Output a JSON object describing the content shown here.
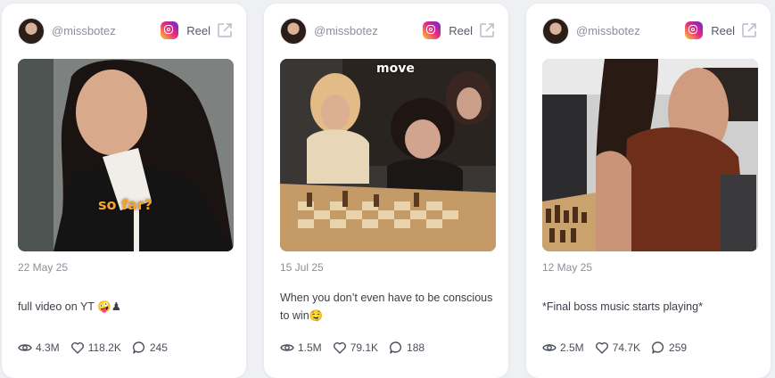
{
  "cards": [
    {
      "handle": "@missbotez",
      "platform_label": "Reel",
      "overlay_text": "so far?",
      "date": "22 May 25",
      "caption": "full video on YT 🤪♟",
      "stats": {
        "views": "4.3M",
        "likes": "118.2K",
        "comments": "245"
      }
    },
    {
      "handle": "@missbotez",
      "platform_label": "Reel",
      "overlay_text": "move",
      "date": "15 Jul 25",
      "caption": "When you don’t even have to be conscious to win🤤",
      "stats": {
        "views": "1.5M",
        "likes": "79.1K",
        "comments": "188"
      }
    },
    {
      "handle": "@missbotez",
      "platform_label": "Reel",
      "overlay_text": "",
      "date": "12 May 25",
      "caption": "*Final boss music starts playing*",
      "stats": {
        "views": "2.5M",
        "likes": "74.7K",
        "comments": "259"
      }
    }
  ],
  "icons": {
    "platform": "instagram-icon",
    "external": "external-link-icon",
    "views": "eye-icon",
    "likes": "heart-icon",
    "comments": "comment-icon"
  },
  "colors": {
    "card_bg": "#ffffff",
    "page_bg": "#eef0f4",
    "overlay_orange": "#f4a52a",
    "overlay_white": "#ffffff"
  }
}
